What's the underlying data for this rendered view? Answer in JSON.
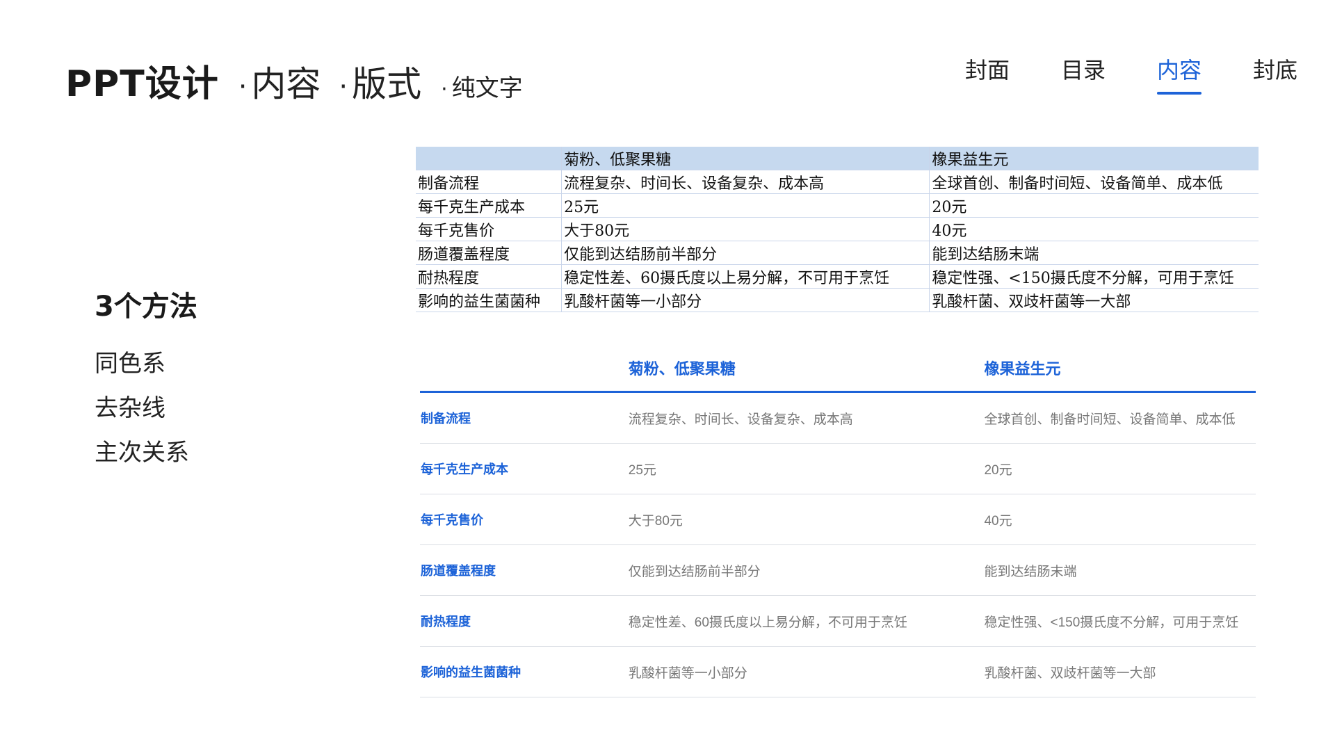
{
  "header": {
    "title": "PPT设计",
    "dot": "·",
    "crumbs": [
      "内容",
      "版式",
      "纯文字"
    ]
  },
  "nav": {
    "items": [
      "封面",
      "目录",
      "内容",
      "封底"
    ],
    "active": "内容",
    "accent_color": "#1d63d8"
  },
  "left": {
    "title": "3个方法",
    "items": [
      "同色系",
      "去杂线",
      "主次关系"
    ]
  },
  "table_before": {
    "headers": [
      "",
      "菊粉、低聚果糖",
      "橡果益生元"
    ],
    "rows": [
      [
        "制备流程",
        "流程复杂、时间长、设备复杂、成本高",
        "全球首创、制备时间短、设备简单、成本低"
      ],
      [
        "每千克生产成本",
        "25元",
        "20元"
      ],
      [
        "每千克售价",
        "大于80元",
        "40元"
      ],
      [
        "肠道覆盖程度",
        "仅能到达结肠前半部分",
        "能到达结肠末端"
      ],
      [
        "耐热程度",
        "稳定性差、60摄氏度以上易分解，不可用于烹饪",
        "稳定性强、<150摄氏度不分解，可用于烹饪"
      ],
      [
        "影响的益生菌菌种",
        "乳酸杆菌等一小部分",
        "乳酸杆菌、双歧杆菌等一大部"
      ]
    ]
  },
  "table_after": {
    "headers": [
      "",
      "菊粉、低聚果糖",
      "橡果益生元"
    ],
    "rows": [
      [
        "制备流程",
        "流程复杂、时间长、设备复杂、成本高",
        "全球首创、制备时间短、设备简单、成本低"
      ],
      [
        "每千克生产成本",
        "25元",
        "20元"
      ],
      [
        "每千克售价",
        "大于80元",
        "40元"
      ],
      [
        "肠道覆盖程度",
        "仅能到达结肠前半部分",
        "能到达结肠末端"
      ],
      [
        "耐热程度",
        "稳定性差、60摄氏度以上易分解，不可用于烹饪",
        "稳定性强、<150摄氏度不分解，可用于烹饪"
      ],
      [
        "影响的益生菌菌种",
        "乳酸杆菌等一小部分",
        "乳酸杆菌、双歧杆菌等一大部"
      ]
    ]
  }
}
